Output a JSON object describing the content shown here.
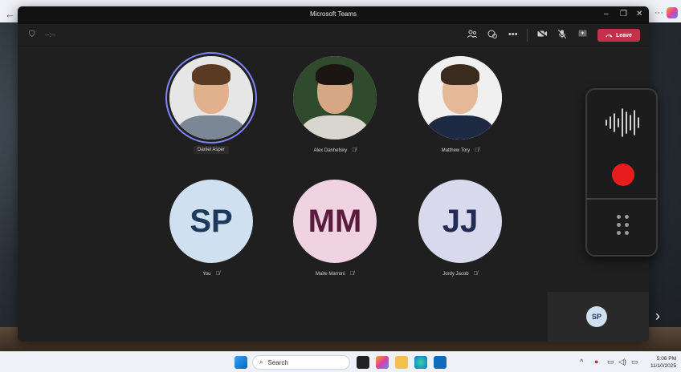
{
  "window": {
    "title": "Microsoft Teams",
    "minimize": "–",
    "maximize": "❐",
    "close": "✕"
  },
  "toolbar": {
    "timer": "--:--",
    "leave_label": "Leave"
  },
  "participants": [
    {
      "name": "Daniel Asper",
      "kind": "photo",
      "selected": true
    },
    {
      "name": "Alex Danhefsky",
      "kind": "photo",
      "muted": true
    },
    {
      "name": "Matthew Tory",
      "kind": "photo",
      "muted": true
    },
    {
      "name": "You",
      "initials": "SP",
      "bg": "#cfe0f0",
      "fg": "#1d3a5c",
      "muted": true
    },
    {
      "name": "Maite Marroni",
      "initials": "MM",
      "bg": "#efd3e0",
      "fg": "#5b1b3c",
      "muted": true
    },
    {
      "name": "Jordy Jacob",
      "initials": "JJ",
      "bg": "#d8d9ec",
      "fg": "#232a55",
      "muted": true
    }
  ],
  "self_view": {
    "initials": "SP"
  },
  "taskbar": {
    "search_placeholder": "Search",
    "time": "5:06 PM",
    "date": "11/10/2025"
  },
  "colors": {
    "leave": "#c4314b",
    "speaking_ring": "#7f85f5",
    "record": "#e81c1c"
  }
}
